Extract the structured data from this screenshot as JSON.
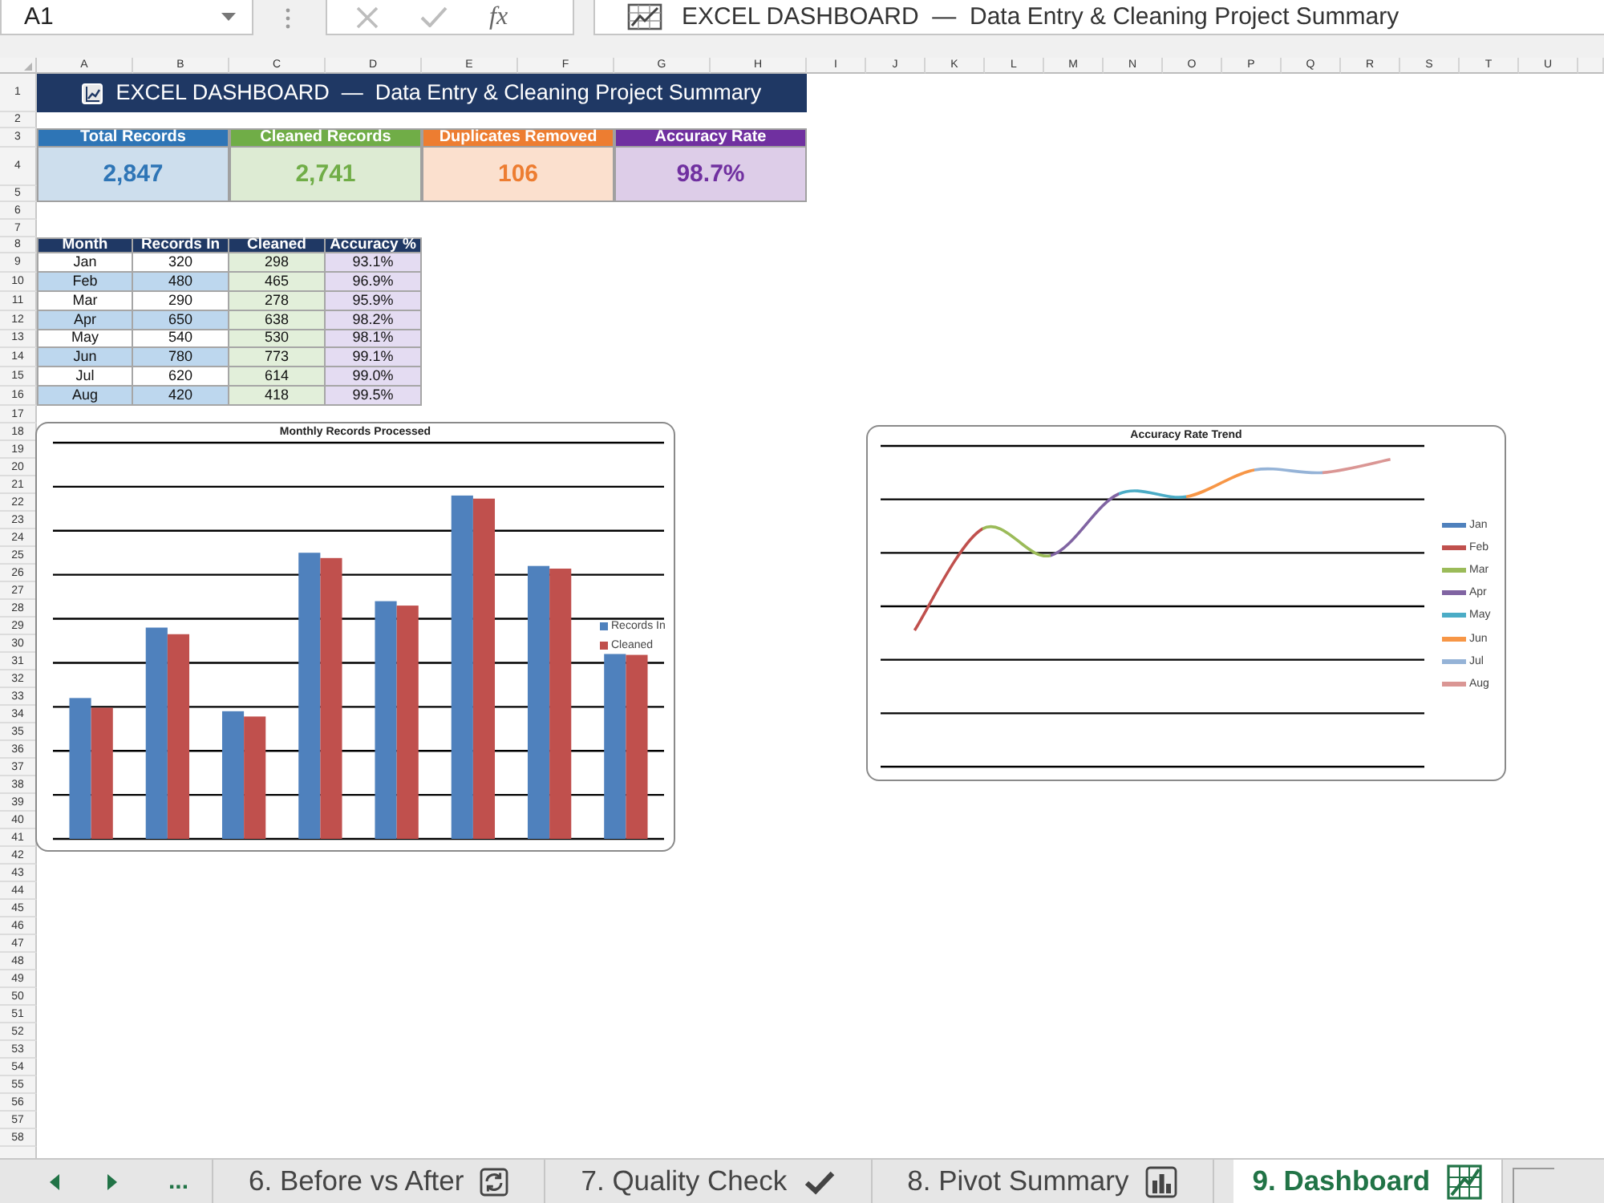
{
  "formula_bar": {
    "name_box": "A1",
    "function_label": "fx",
    "content": "EXCEL DASHBOARD  —  Data Entry & Cleaning Project Summary"
  },
  "columns": [
    "A",
    "B",
    "C",
    "D",
    "E",
    "F",
    "G",
    "H",
    "I",
    "J",
    "K",
    "L",
    "M",
    "N",
    "O",
    "P",
    "Q",
    "R",
    "S",
    "T",
    "U"
  ],
  "rows": [
    "1",
    "2",
    "3",
    "4",
    "5",
    "6",
    "7",
    "8",
    "9",
    "10",
    "11",
    "12",
    "13",
    "14",
    "15",
    "16",
    "17",
    "18",
    "19",
    "20",
    "21",
    "22",
    "23",
    "24",
    "25",
    "26",
    "27",
    "28",
    "29",
    "30",
    "31",
    "32",
    "33",
    "34",
    "35",
    "36",
    "37",
    "38",
    "39",
    "40",
    "41",
    "42",
    "43",
    "44",
    "45",
    "46",
    "47",
    "48",
    "49",
    "50",
    "51",
    "52",
    "53",
    "54",
    "55",
    "56",
    "57",
    "58"
  ],
  "banner": {
    "title": "EXCEL DASHBOARD  —  Data Entry & Cleaning Project Summary"
  },
  "kpis": [
    {
      "label": "Total Records",
      "value": "2,847",
      "color": "#2e75b6"
    },
    {
      "label": "Cleaned Records",
      "value": "2,741",
      "color": "#70ad47"
    },
    {
      "label": "Duplicates Removed",
      "value": "106",
      "color": "#ed7d31"
    },
    {
      "label": "Accuracy Rate",
      "value": "98.7%",
      "color": "#7030a0"
    }
  ],
  "table": {
    "columns": [
      "Month",
      "Records In",
      "Cleaned",
      "Accuracy %"
    ],
    "rows": [
      [
        "Jan",
        "320",
        "298",
        "93.1%"
      ],
      [
        "Feb",
        "480",
        "465",
        "96.9%"
      ],
      [
        "Mar",
        "290",
        "278",
        "95.9%"
      ],
      [
        "Apr",
        "650",
        "638",
        "98.2%"
      ],
      [
        "May",
        "540",
        "530",
        "98.1%"
      ],
      [
        "Jun",
        "780",
        "773",
        "99.1%"
      ],
      [
        "Jul",
        "620",
        "614",
        "99.0%"
      ],
      [
        "Aug",
        "420",
        "418",
        "99.5%"
      ]
    ]
  },
  "bar_chart": {
    "title": "Monthly Records Processed",
    "legend": [
      {
        "label": "Records In",
        "color": "#4f81bd"
      },
      {
        "label": "Cleaned",
        "color": "#c0504d"
      }
    ]
  },
  "line_chart": {
    "title": "Accuracy Rate Trend",
    "legend": [
      {
        "label": "Jan",
        "color": "#4f81bd"
      },
      {
        "label": "Feb",
        "color": "#c0504d"
      },
      {
        "label": "Mar",
        "color": "#9bbb59"
      },
      {
        "label": "Apr",
        "color": "#8064a2"
      },
      {
        "label": "May",
        "color": "#4bacc6"
      },
      {
        "label": "Jun",
        "color": "#f79646"
      },
      {
        "label": "Jul",
        "color": "#95b3d7"
      },
      {
        "label": "Aug",
        "color": "#da9694"
      }
    ]
  },
  "sheet_tabs": {
    "more": "...",
    "tabs": [
      {
        "label": "6. Before vs After",
        "selected": false
      },
      {
        "label": "7. Quality Check",
        "selected": false
      },
      {
        "label": "8. Pivot Summary",
        "selected": false
      },
      {
        "label": "9. Dashboard",
        "selected": true
      }
    ]
  }
}
